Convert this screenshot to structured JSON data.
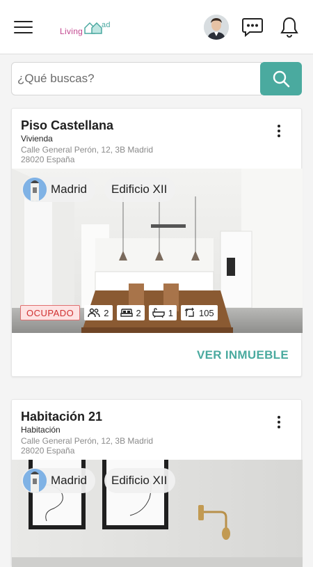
{
  "app": {
    "logo_text_left": "Living",
    "logo_text_right": "ad"
  },
  "search": {
    "placeholder": "¿Qué buscas?"
  },
  "colors": {
    "accent": "#4aaa9f",
    "status_occupied": "#d03030"
  },
  "icons": {
    "menu": "hamburger-icon",
    "messages": "chat-bubble-icon",
    "notifications": "bell-icon",
    "search": "search-icon"
  },
  "properties": [
    {
      "title": "Piso Castellana",
      "type": "Vivienda",
      "address_line1": "Calle General Perón, 12, 3B Madrid",
      "address_line2": "28020 España",
      "city_chip": "Madrid",
      "building_chip": "Edificio XII",
      "status": "OCUPADO",
      "stats": {
        "people": "2",
        "beds": "2",
        "baths": "1",
        "area": "105"
      },
      "cta": "VER INMUEBLE"
    },
    {
      "title": "Habitación 21",
      "type": "Habitación",
      "address_line1": "Calle General Perón, 12, 3B Madrid",
      "address_line2": "28020 España",
      "city_chip": "Madrid",
      "building_chip": "Edificio XII"
    }
  ]
}
